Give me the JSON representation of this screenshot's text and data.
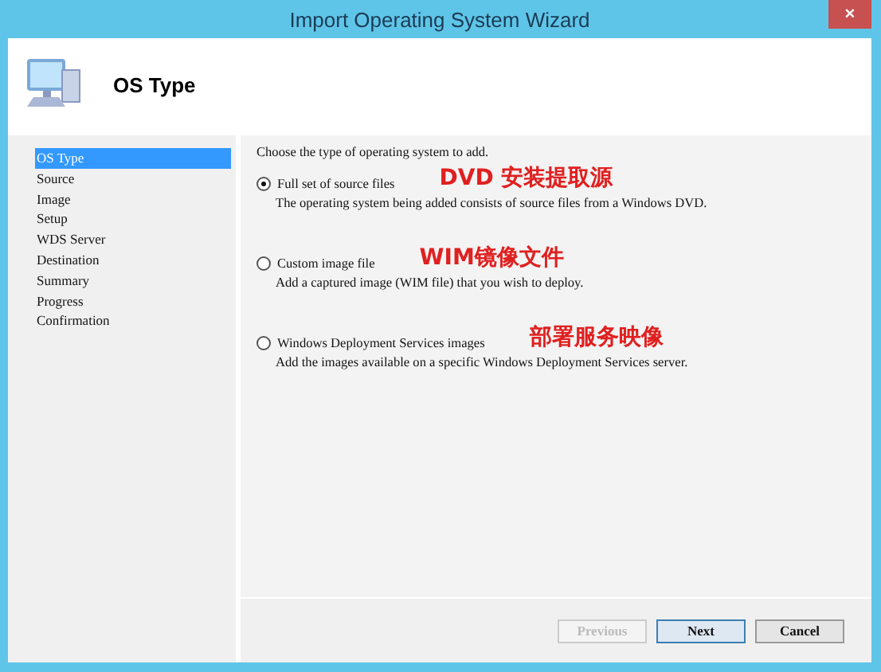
{
  "window": {
    "title": "Import Operating System Wizard",
    "close": "×"
  },
  "header": {
    "title": "OS Type"
  },
  "steps": [
    {
      "label": "OS Type",
      "selected": true
    },
    {
      "label": "Source",
      "selected": false
    },
    {
      "label": "Image",
      "selected": false
    },
    {
      "label": "Setup",
      "selected": false
    },
    {
      "label": "WDS Server",
      "selected": false
    },
    {
      "label": "Destination",
      "selected": false
    },
    {
      "label": "Summary",
      "selected": false
    },
    {
      "label": "Progress",
      "selected": false
    },
    {
      "label": "Confirmation",
      "selected": false
    }
  ],
  "prompt": "Choose the type of operating system to add.",
  "options": [
    {
      "label": "Full set of source files",
      "description": "The operating system being added consists of source files from a Windows DVD.",
      "selected": true,
      "annotation": "DVD 安装提取源"
    },
    {
      "label": "Custom image file",
      "description": "Add a captured image (WIM file) that you wish to deploy.",
      "selected": false,
      "annotation": "WIM镜像文件"
    },
    {
      "label": "Windows Deployment Services images",
      "description": "Add the images available on a specific Windows Deployment Services server.",
      "selected": false,
      "annotation": "部署服务映像"
    }
  ],
  "buttons": [
    {
      "label": "Previous",
      "disabled": true,
      "kind": "default"
    },
    {
      "label": "Next",
      "disabled": false,
      "kind": "primary"
    },
    {
      "label": "Cancel",
      "disabled": false,
      "kind": "default"
    }
  ]
}
